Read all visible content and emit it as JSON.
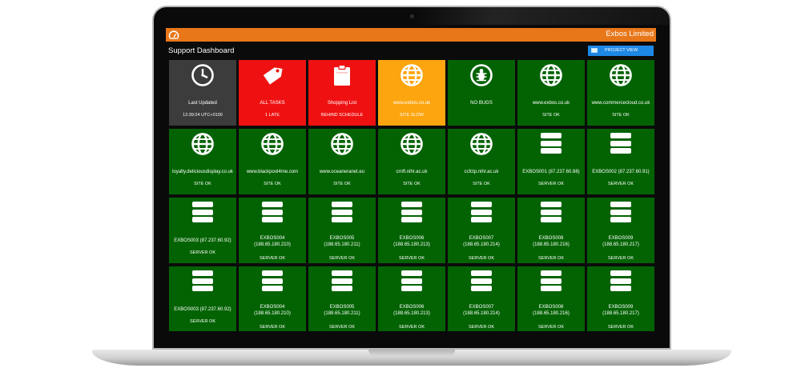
{
  "header": {
    "company": "Exbos Limited",
    "title": "Support Dashboard",
    "project_view_label": "PROJECT VIEW"
  },
  "colors": {
    "topbar": "#e8771a",
    "ok": "#036303",
    "late": "#ef1111",
    "warning": "#fda50f",
    "neutral": "#3c3c3c",
    "button": "#1e88e5"
  },
  "tiles": [
    {
      "icon": "clock-icon",
      "color": "dark",
      "label": "Last Updated",
      "status": "12:39:24 UTC+0100"
    },
    {
      "icon": "tag-icon",
      "color": "red",
      "label": "ALL TASKS",
      "status": "1 LATE"
    },
    {
      "icon": "clipboard-icon",
      "color": "red",
      "label": "Shopping List",
      "status": "BEHIND SCHEDULE"
    },
    {
      "icon": "globe-icon",
      "color": "orange",
      "label": "www.exbos.co.uk",
      "status": "SITE SLOW"
    },
    {
      "icon": "bug-icon",
      "color": "green",
      "label": "NO BUGS",
      "status": ""
    },
    {
      "icon": "globe-icon",
      "color": "green",
      "label": "www.exbos.co.uk",
      "status": "SITE OK"
    },
    {
      "icon": "globe-icon",
      "color": "green",
      "label": "www.commercecloud.co.uk",
      "status": "SITE OK"
    },
    {
      "icon": "globe-icon",
      "color": "green",
      "label": "loyalty.deliciousdisplay.co.uk",
      "status": "SITE OK"
    },
    {
      "icon": "globe-icon",
      "color": "green",
      "label": "www.blackpool4me.com",
      "status": "SITE OK"
    },
    {
      "icon": "globe-icon",
      "color": "green",
      "label": "www.oceaneranet.eu",
      "status": "SITE OK"
    },
    {
      "icon": "globe-icon",
      "color": "green",
      "label": "crnft.nihr.ac.uk",
      "status": "SITE OK"
    },
    {
      "icon": "globe-icon",
      "color": "green",
      "label": "ccfctp.nihr.ac.uk",
      "status": "SITE OK"
    },
    {
      "icon": "server-icon",
      "color": "green",
      "label": "EXBOS001 (87.237.60.88)",
      "status": "SERVER OK"
    },
    {
      "icon": "server-icon",
      "color": "green",
      "label": "EXBOS002 (87.237.60.91)",
      "status": "SERVER OK"
    },
    {
      "icon": "server-icon",
      "color": "green",
      "label": "EXBOS003 (87.237.60.92)",
      "status": "SERVER OK"
    },
    {
      "icon": "server-icon",
      "color": "green",
      "label": "EXBOS004",
      "label2": "(188.65.180.210)",
      "status": "SERVER OK"
    },
    {
      "icon": "server-icon",
      "color": "green",
      "label": "EXBOS005",
      "label2": "(188.65.180.211)",
      "status": "SERVER OK"
    },
    {
      "icon": "server-icon",
      "color": "green",
      "label": "EXBOS006",
      "label2": "(188.65.180.213)",
      "status": "SERVER OK"
    },
    {
      "icon": "server-icon",
      "color": "green",
      "label": "EXBOS007",
      "label2": "(188.65.180.214)",
      "status": "SERVER OK"
    },
    {
      "icon": "server-icon",
      "color": "green",
      "label": "EXBOS008",
      "label2": "(188.65.180.216)",
      "status": "SERVER OK"
    },
    {
      "icon": "server-icon",
      "color": "green",
      "label": "EXBOS009",
      "label2": "(188.65.180.217)",
      "status": "SERVER OK"
    },
    {
      "icon": "server-icon",
      "color": "green",
      "label": "EXBOS003 (87.237.60.92)",
      "status": "SERVER OK"
    },
    {
      "icon": "server-icon",
      "color": "green",
      "label": "EXBOS004",
      "label2": "(188.65.180.210)",
      "status": "SERVER OK"
    },
    {
      "icon": "server-icon",
      "color": "green",
      "label": "EXBOS005",
      "label2": "(188.65.180.211)",
      "status": "SERVER OK"
    },
    {
      "icon": "server-icon",
      "color": "green",
      "label": "EXBOS006",
      "label2": "(188.65.180.213)",
      "status": "SERVER OK"
    },
    {
      "icon": "server-icon",
      "color": "green",
      "label": "EXBOS007",
      "label2": "(188.65.180.214)",
      "status": "SERVER OK"
    },
    {
      "icon": "server-icon",
      "color": "green",
      "label": "EXBOS008",
      "label2": "(188.65.180.216)",
      "status": "SERVER OK"
    },
    {
      "icon": "server-icon",
      "color": "green",
      "label": "EXBOS009",
      "label2": "(188.65.180.217)",
      "status": "SERVER OK"
    }
  ]
}
